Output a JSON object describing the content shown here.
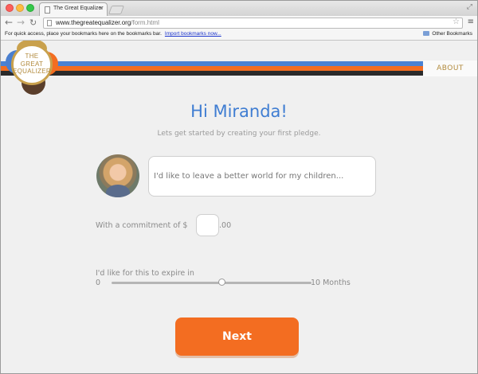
{
  "browser": {
    "tab_title": "The Great Equalizer",
    "tab_close": "×",
    "url_host": "www.thegreatequalizer.org",
    "url_path": "/form.html",
    "bookmarks_text": "For quick access, place your bookmarks here on the bookmarks bar.",
    "bookmarks_link": "Import bookmarks now...",
    "other_bookmarks": "Other Bookmarks"
  },
  "header": {
    "logo_line1": "THE",
    "logo_line2": "GREAT",
    "logo_line3": "EQUALIZER",
    "nav_about": "ABOUT",
    "stripe_colors": [
      "#4a82d4",
      "#f36d21",
      "#2a2a2a"
    ]
  },
  "form": {
    "greeting": "Hi Miranda!",
    "subtitle": "Lets get started by creating your first pledge.",
    "pledge_placeholder": "I'd like to leave a better world for my children...",
    "commitment_label": "With a commitment of $",
    "commitment_cents": ".00",
    "expire_label": "I'd like for this to expire in",
    "slider_min": "0",
    "slider_max": "10 Months",
    "slider_value_fraction": 0.55,
    "next_button": "Next"
  },
  "colors": {
    "accent_blue": "#3f7dd2",
    "accent_orange": "#f36d21",
    "logo_gold": "#c9a14d"
  }
}
